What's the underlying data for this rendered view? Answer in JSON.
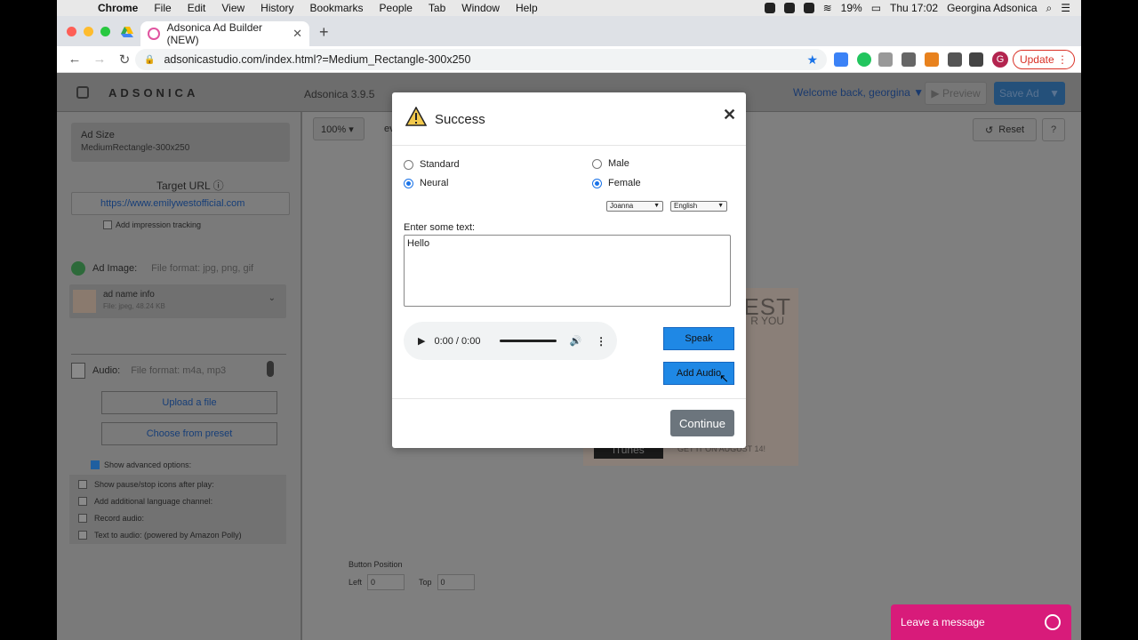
{
  "menubar": {
    "app": "Chrome",
    "items": [
      "File",
      "Edit",
      "View",
      "History",
      "Bookmarks",
      "People",
      "Tab",
      "Window",
      "Help"
    ],
    "battery": "19%",
    "clock": "Thu 17:02",
    "user": "Georgina Adsonica"
  },
  "browser": {
    "tab_title": "Adsonica Ad Builder (NEW)",
    "url": "adsonicastudio.com/index.html?=Medium_Rectangle-300x250",
    "update_label": "Update",
    "profile_initial": "G"
  },
  "app": {
    "logo": "ADSONICA",
    "version": "Adsonica 3.9.5",
    "welcome": "Welcome back, georgina",
    "preview_label": "Preview",
    "save_label": "Save Ad",
    "zoom": "100%",
    "zoom_partial": "ev",
    "reset_label": "Reset",
    "help_label": "?"
  },
  "sidebar": {
    "adsize_title": "Ad Size",
    "adsize_value": "MediumRectangle-300x250",
    "target_label": "Target URL",
    "target_url": "https://www.emilywestofficial.com",
    "impression_label": "Add impression tracking",
    "adimage_label": "Ad Image:",
    "adimage_format": "File format: jpg, png, gif",
    "image_name": "ad name info",
    "image_info": "File: jpeg, 48.24 KB",
    "audio_label": "Audio:",
    "audio_format": "File format: m4a, mp3",
    "upload_label": "Upload a file",
    "preset_label": "Choose from preset",
    "advanced_label": "Show advanced options:",
    "advanced_items": [
      "Show pause/stop icons after play:",
      "Add additional language channel:",
      "Record audio:",
      "Text to audio: (powered by Amazon Polly)"
    ]
  },
  "canvas": {
    "banner_title": "EST",
    "banner_sub": "R YOU",
    "itunes": "iTunes",
    "banner_date": "GET IT ON AUGUST 14!",
    "button_position": "Button Position",
    "left_label": "Left",
    "left_value": "0",
    "top_label": "Top",
    "top_value": "0"
  },
  "modal": {
    "title": "Success",
    "engine_options": [
      "Standard",
      "Neural"
    ],
    "engine_selected": "Neural",
    "gender_options": [
      "Male",
      "Female"
    ],
    "gender_selected": "Female",
    "voice": "Joanna",
    "language": "English",
    "text_label": "Enter some text:",
    "text_value": "Hello",
    "player_time": "0:00 / 0:00",
    "speak_label": "Speak",
    "add_audio_label": "Add Audio",
    "continue_label": "Continue"
  },
  "chat": {
    "label": "Leave a message"
  },
  "colors": {
    "primary_button": "#1f88e5",
    "continue_button": "#6c757d",
    "chat_widget": "#d81b7a",
    "update_red": "#d93025"
  }
}
